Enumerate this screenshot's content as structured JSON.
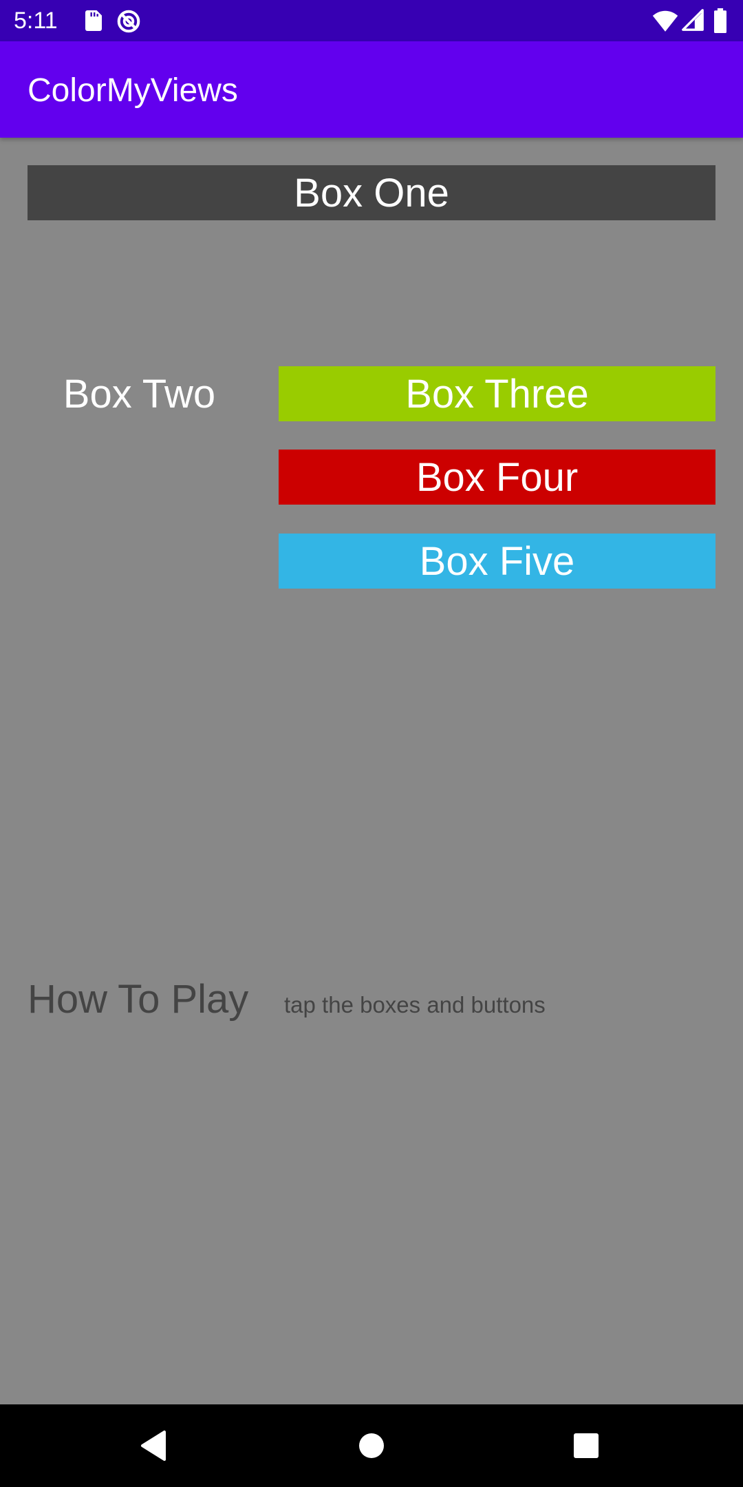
{
  "status_bar": {
    "time": "5:11",
    "background": "#3700B3",
    "icons": [
      "sd-card-icon",
      "data-saver-icon",
      "wifi-icon",
      "signal-icon",
      "battery-icon"
    ]
  },
  "app_bar": {
    "title": "ColorMyViews",
    "background": "#6200EE"
  },
  "boxes": {
    "one": {
      "label": "Box One",
      "color": "#444444"
    },
    "two": {
      "label": "Box Two",
      "color": "#888888"
    },
    "three": {
      "label": "Box Three",
      "color": "#99CC00"
    },
    "four": {
      "label": "Box Four",
      "color": "#CC0000"
    },
    "five": {
      "label": "Box Five",
      "color": "#33B5E5"
    }
  },
  "info": {
    "label": "How To Play",
    "text": "tap the boxes and buttons",
    "text_color": "#444444"
  },
  "screen_background": "#888888",
  "nav_bar": {
    "icons": [
      "back-icon",
      "home-icon",
      "recents-icon"
    ]
  }
}
